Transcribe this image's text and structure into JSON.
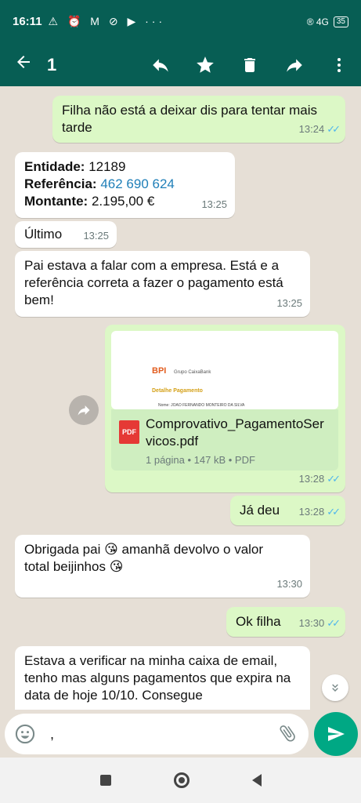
{
  "status_bar": {
    "time": "16:11",
    "icons_left": "⚠ ⏰ M ⊘ ▶ ···",
    "battery": "35",
    "icons_right": "® 4G"
  },
  "app_bar": {
    "selected_count": "1",
    "icons": [
      "back-arrow-icon",
      "reply-icon",
      "star-icon",
      "delete-icon",
      "forward-icon",
      "more-vert-icon"
    ]
  },
  "colors": {
    "header": "#075e54",
    "outgoing_bubble": "#dcf8c6",
    "incoming_bubble": "#ffffff",
    "read_ticks": "#4fb6ec",
    "send_button": "#00a884",
    "chat_bg": "#e6dfd6"
  },
  "messages": [
    {
      "id": "m1",
      "dir": "out",
      "text": "Filha não está a deixar  dis para tentar mais tarde",
      "time": "13:24",
      "read": true
    },
    {
      "id": "m2",
      "dir": "in",
      "lines": [
        {
          "label": "Entidade:",
          "value": "12189"
        },
        {
          "label": "Referência:",
          "value": "462 690 624"
        },
        {
          "label": "Montante:",
          "value": "2.195,00 €"
        }
      ],
      "time": "13:25"
    },
    {
      "id": "m3",
      "dir": "in",
      "text": "Último",
      "time": "13:25"
    },
    {
      "id": "m4",
      "dir": "in",
      "text": "Pai estava a falar com a empresa. Está e a referência correta a fazer o pagamento está bem!",
      "time": "13:25"
    },
    {
      "id": "m5",
      "dir": "out",
      "type": "document",
      "thumb": {
        "logo": "BPI",
        "group": "Grupo CaixaBank",
        "heading": "Detalhe Pagamento",
        "line": "Nome: JOAO FERNANDO MONTEIRO DA SILVA"
      },
      "file_name": "Comprovativo_PagamentoServicos.pdf",
      "file_name_line1": "Comprovativo_PagamentoSer",
      "file_name_line2": "vicos.pdf",
      "pdf_badge": "PDF",
      "meta": "1 página • 147 kB • PDF",
      "time": "13:28",
      "read": true
    },
    {
      "id": "m6",
      "dir": "out",
      "text": "Já deu",
      "time": "13:28",
      "read": true
    },
    {
      "id": "m7",
      "dir": "in",
      "line1": "Obrigada  pai",
      "line1b": "amanhã devolvo o valor",
      "line2": "total beijinhos",
      "emoji": "😘",
      "time": "13:30"
    },
    {
      "id": "m8",
      "dir": "out",
      "text": "Ok filha",
      "time": "13:30",
      "read": true
    },
    {
      "id": "m9",
      "dir": "in",
      "text": "Estava a verificar na minha caixa de email, tenho mas alguns pagamentos que expira na data de hoje 10/10. Consegue"
    }
  ],
  "input": {
    "value": ","
  }
}
